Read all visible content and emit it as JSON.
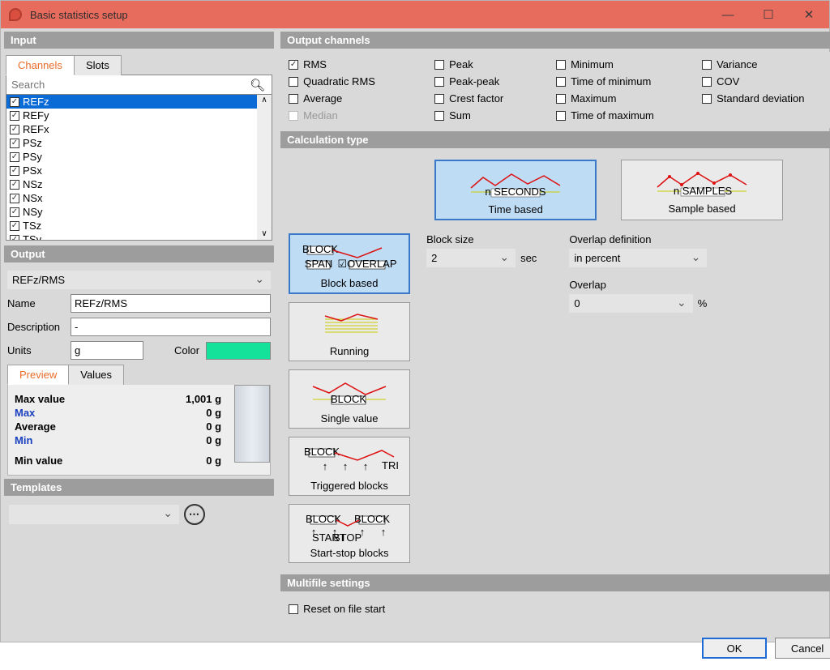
{
  "title": "Basic statistics setup",
  "win_buttons": {
    "min": "—",
    "max": "☐",
    "close": "✕"
  },
  "left": {
    "input_hdr": "Input",
    "tabs": {
      "channels": "Channels",
      "slots": "Slots"
    },
    "search_placeholder": "Search",
    "channels": [
      "REFz",
      "REFy",
      "REFx",
      "PSz",
      "PSy",
      "PSx",
      "NSz",
      "NSx",
      "NSy",
      "TSz",
      "TSy"
    ],
    "output_hdr": "Output",
    "output_select": "REFz/RMS",
    "name_lbl": "Name",
    "name_val": "REFz/RMS",
    "desc_lbl": "Description",
    "desc_val": "-",
    "units_lbl": "Units",
    "units_val": "g",
    "color_lbl": "Color",
    "subtabs": {
      "preview": "Preview",
      "values": "Values"
    },
    "preview": {
      "maxv_lbl": "Max value",
      "maxv_val": "1,001 g",
      "max_lbl": "Max",
      "max_val": "0 g",
      "avg_lbl": "Average",
      "avg_val": "0 g",
      "min_lbl": "Min",
      "min_val": "0 g",
      "minv_lbl": "Min value",
      "minv_val": "0 g"
    },
    "templates_hdr": "Templates"
  },
  "right": {
    "out_hdr": "Output channels",
    "checks": [
      {
        "label": "RMS",
        "on": true
      },
      {
        "label": "Peak",
        "on": false
      },
      {
        "label": "Minimum",
        "on": false
      },
      {
        "label": "Variance",
        "on": false
      },
      {
        "label": "Quadratic RMS",
        "on": false
      },
      {
        "label": "Peak-peak",
        "on": false
      },
      {
        "label": "Time of minimum",
        "on": false
      },
      {
        "label": "COV",
        "on": false
      },
      {
        "label": "Average",
        "on": false
      },
      {
        "label": "Crest factor",
        "on": false
      },
      {
        "label": "Maximum",
        "on": false
      },
      {
        "label": "Standard deviation",
        "on": false
      },
      {
        "label": "Median",
        "on": false,
        "disabled": true
      },
      {
        "label": "Sum",
        "on": false
      },
      {
        "label": "Time of maximum",
        "on": false
      }
    ],
    "calc_hdr": "Calculation type",
    "calc_btns": {
      "time": "Time based",
      "sample": "Sample based",
      "block": "Block based",
      "running": "Running",
      "single": "Single value",
      "trig": "Triggered blocks",
      "startstop": "Start-stop blocks"
    },
    "block_size_lbl": "Block size",
    "block_size_val": "2",
    "block_size_unit": "sec",
    "overlap_def_lbl": "Overlap definition",
    "overlap_def_val": "in percent",
    "overlap_lbl": "Overlap",
    "overlap_val": "0",
    "overlap_unit": "%",
    "multi_hdr": "Multifile settings",
    "reset_lbl": "Reset on file start",
    "ok": "OK",
    "cancel": "Cancel"
  }
}
